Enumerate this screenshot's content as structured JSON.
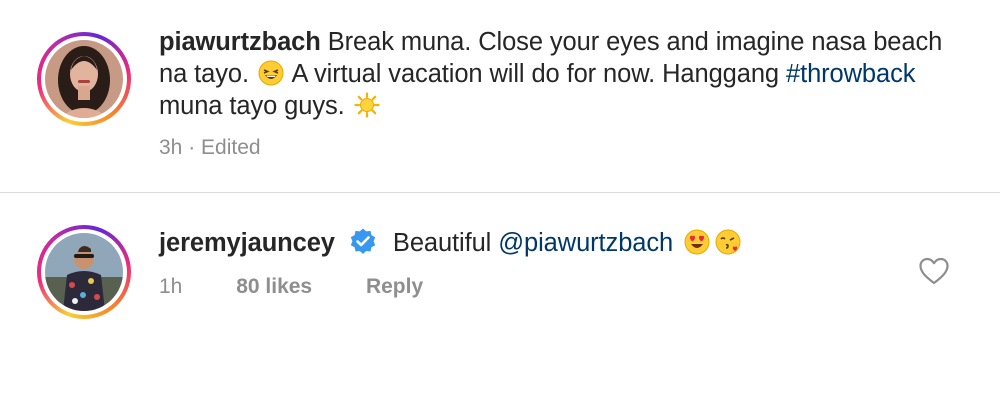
{
  "post": {
    "username": "piawurtzbach",
    "text_1": "Break muna. Close your eyes and imagine nasa beach na tayo.",
    "emoji_1": "grinning-squinting-face-emoji",
    "text_2": "A virtual vacation will do for now. Hanggang",
    "hashtag": "#throwback",
    "text_3": "muna tayo guys.",
    "emoji_2": "sun-emoji",
    "time": "3h",
    "edited": "· Edited"
  },
  "comment": {
    "username": "jeremyjauncey",
    "verified": true,
    "text": "Beautiful",
    "mention": "@piawurtzbach",
    "emojis": [
      "heart-eyes-emoji",
      "face-blowing-kiss-emoji"
    ],
    "time": "1h",
    "likes": "80 likes",
    "reply": "Reply"
  },
  "colors": {
    "link": "#00376b",
    "meta": "#8e8e8e",
    "verified": "#3897f0"
  },
  "icons": [
    "heart-outline-icon",
    "verified-badge-icon"
  ]
}
